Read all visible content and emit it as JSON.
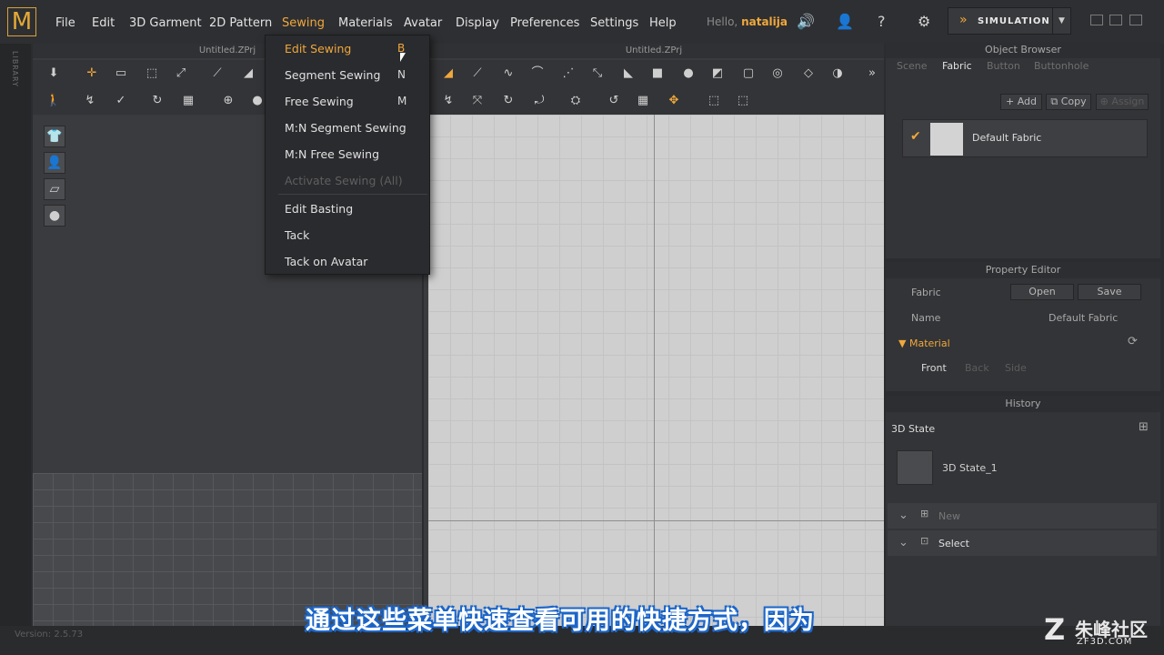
{
  "app": {
    "logo": "M",
    "version": "Version: 2.5.73"
  },
  "menu": {
    "items": [
      "File",
      "Edit",
      "3D Garment",
      "2D Pattern",
      "Sewing",
      "Materials",
      "Avatar",
      "Display",
      "Preferences",
      "Settings",
      "Help"
    ],
    "active": "Sewing"
  },
  "user": {
    "hello": "Hello,",
    "name": "natalija"
  },
  "simulation": {
    "label": "SIMULATION"
  },
  "panel3d": {
    "title": "Untitled.ZPrj"
  },
  "panel2d": {
    "title": "Untitled.ZPrj"
  },
  "library": {
    "label": "LIBRARY"
  },
  "dropdown": {
    "items": [
      {
        "label": "Edit Sewing",
        "key": "B",
        "state": "highlighted"
      },
      {
        "label": "Segment Sewing",
        "key": "N",
        "state": "normal"
      },
      {
        "label": "Free Sewing",
        "key": "M",
        "state": "normal"
      },
      {
        "label": "M:N Segment Sewing",
        "key": "",
        "state": "normal"
      },
      {
        "label": "M:N Free Sewing",
        "key": "",
        "state": "normal"
      },
      {
        "label": "Activate Sewing (All)",
        "key": "",
        "state": "disabled"
      },
      {
        "label": "Edit Basting",
        "key": "",
        "state": "normal"
      },
      {
        "label": "Tack",
        "key": "",
        "state": "normal"
      },
      {
        "label": "Tack on Avatar",
        "key": "",
        "state": "normal"
      }
    ]
  },
  "objectBrowser": {
    "title": "Object Browser",
    "tabs": [
      "Scene",
      "Fabric",
      "Button",
      "Buttonhole"
    ],
    "activeTab": "Fabric",
    "buttons": {
      "add": "Add",
      "copy": "Copy",
      "assign": "Assign"
    },
    "fabric": {
      "name": "Default Fabric",
      "checked": true
    }
  },
  "propertyEditor": {
    "title": "Property Editor",
    "fabricLabel": "Fabric",
    "openLabel": "Open",
    "saveLabel": "Save",
    "nameLabel": "Name",
    "nameValue": "Default Fabric",
    "materialLabel": "Material",
    "subtabs": [
      "Front",
      "Back",
      "Side"
    ],
    "activeSubtab": "Front"
  },
  "history": {
    "title": "History",
    "stateLabel": "3D State",
    "entry": "3D State_1",
    "newLabel": "New",
    "selectLabel": "Select"
  },
  "subtitle": {
    "text": "通过这些菜单快速查看可用的快捷方式，因为"
  },
  "watermark": {
    "cn": "朱峰社区",
    "en": "ZF3D.COM"
  },
  "colors": {
    "accent": "#f0a83c",
    "subtitle_outline": "#1c66c9"
  }
}
